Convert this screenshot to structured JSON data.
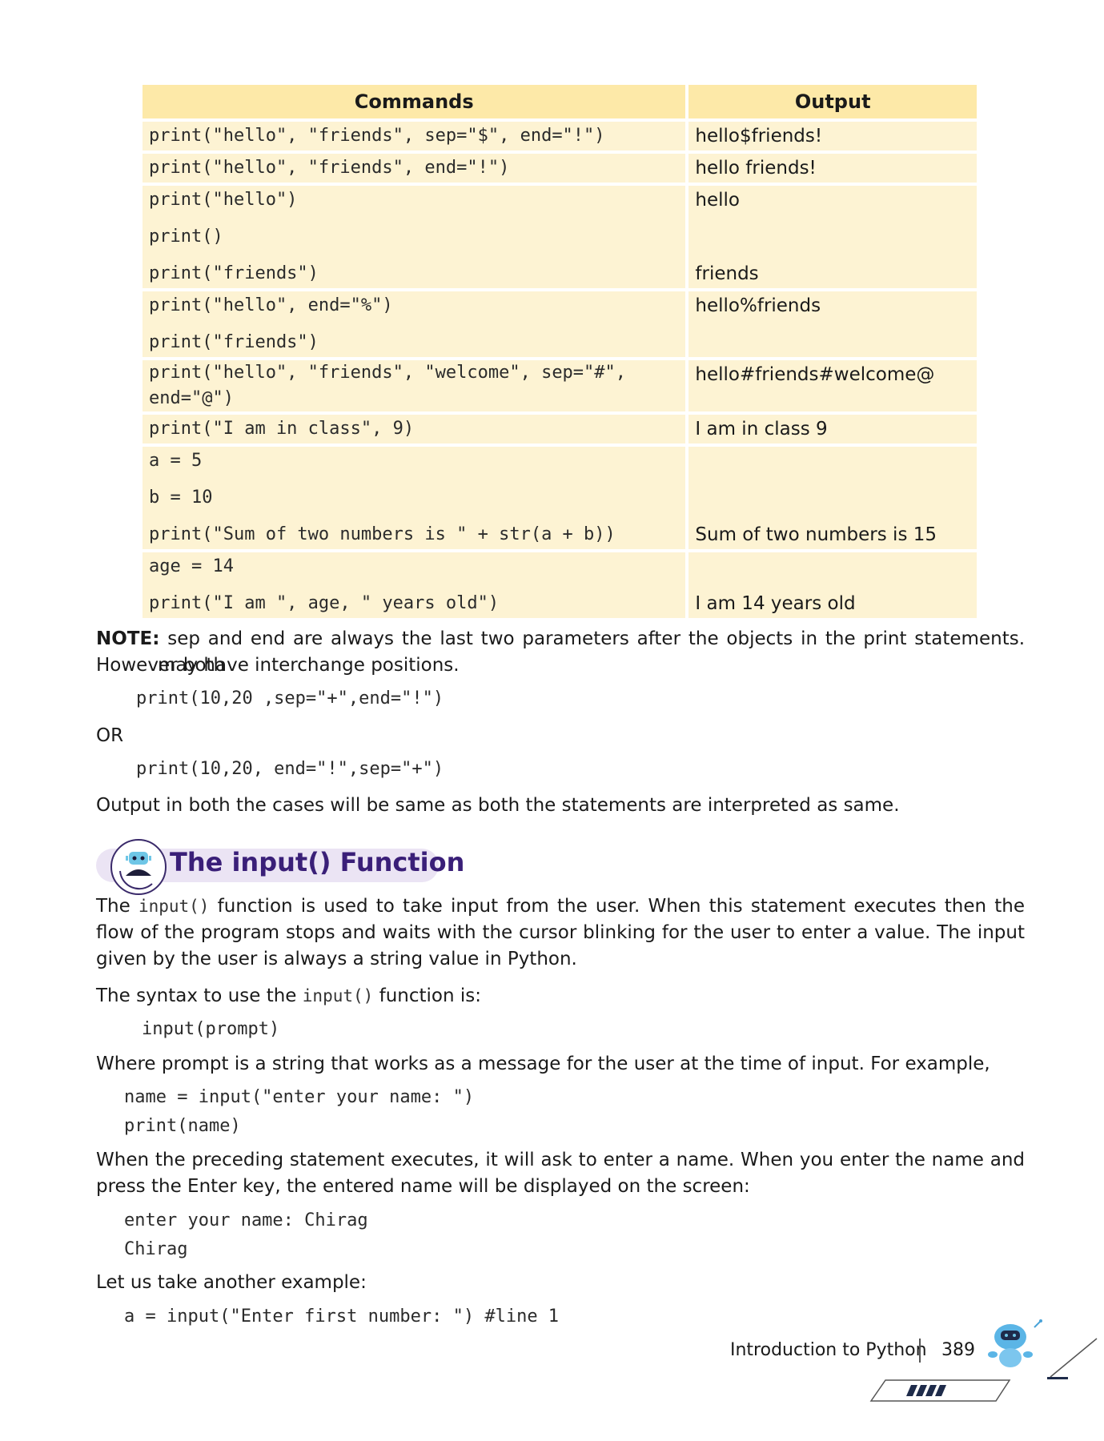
{
  "table": {
    "headers": {
      "commands": "Commands",
      "output": "Output"
    },
    "rows": [
      {
        "commands": [
          "print(\"hello\", \"friends\", sep=\"$\", end=\"!\")"
        ],
        "outputs": [
          "hello$friends!"
        ]
      },
      {
        "commands": [
          "print(\"hello\", \"friends\", end=\"!\")"
        ],
        "outputs": [
          "hello friends!"
        ]
      },
      {
        "commands": [
          "print(\"hello\")",
          "print()",
          "print(\"friends\")"
        ],
        "outputs": [
          "hello",
          "",
          "friends"
        ]
      },
      {
        "commands": [
          "print(\"hello\", end=\"%\")",
          "print(\"friends\")"
        ],
        "outputs": [
          "hello%friends"
        ]
      },
      {
        "commands": [
          "print(\"hello\", \"friends\", \"welcome\", sep=\"#\",",
          "end=\"@\")"
        ],
        "outputs": [
          "hello#friends#welcome@"
        ]
      },
      {
        "commands": [
          "print(\"I am in class\", 9)"
        ],
        "outputs": [
          "I am in class 9"
        ]
      },
      {
        "commands": [
          "a = 5",
          "b = 10",
          "print(\"Sum of two numbers is \" + str(a + b))"
        ],
        "outputs": [
          "",
          "",
          "Sum of two numbers is 15"
        ]
      },
      {
        "commands": [
          "age = 14",
          "print(\"I am \", age, \" years old\")"
        ],
        "outputs": [
          "",
          "I am 14 years old"
        ]
      }
    ]
  },
  "note": {
    "label": "NOTE:",
    "text1": "sep and end are always the last two parameters after the objects in the print statements. However both",
    "text2": "may have interchange positions.",
    "code1": "print(10,20 ,sep=\"+\",end=\"!\")",
    "or": "OR",
    "code2": "print(10,20, end=\"!\",sep=\"+\")",
    "conclusion": "Output in both the cases will be same as both the statements are interpreted as same."
  },
  "section": {
    "heading": "The input() Function",
    "p1_a": "The",
    "p1_code": "input()",
    "p1_b": "function is used to take input from the user. When this statement executes then the flow of the program stops and waits with the cursor blinking for the user to enter a value. The input given by the user is always a string value in Python.",
    "p2_a": "The syntax to use the",
    "p2_code": "input()",
    "p2_b": "function is:",
    "syntax": "input(prompt)",
    "p3": "Where prompt is a string that works as a message for the user at the time of input. For example,",
    "ex1_line1": "name = input(\"enter your name: \")",
    "ex1_line2": "print(name)",
    "p4": "When the preceding statement executes, it will ask to enter a name. When you enter the name and press the Enter key, the entered name will be displayed on the screen:",
    "out_line1": "enter your name: Chirag",
    "out_line2": "Chirag",
    "p5": "Let us take another example:",
    "ex2_line1": "a = input(\"Enter first number: \") #line 1"
  },
  "footer": {
    "title": "Introduction to Python",
    "page": "389"
  }
}
